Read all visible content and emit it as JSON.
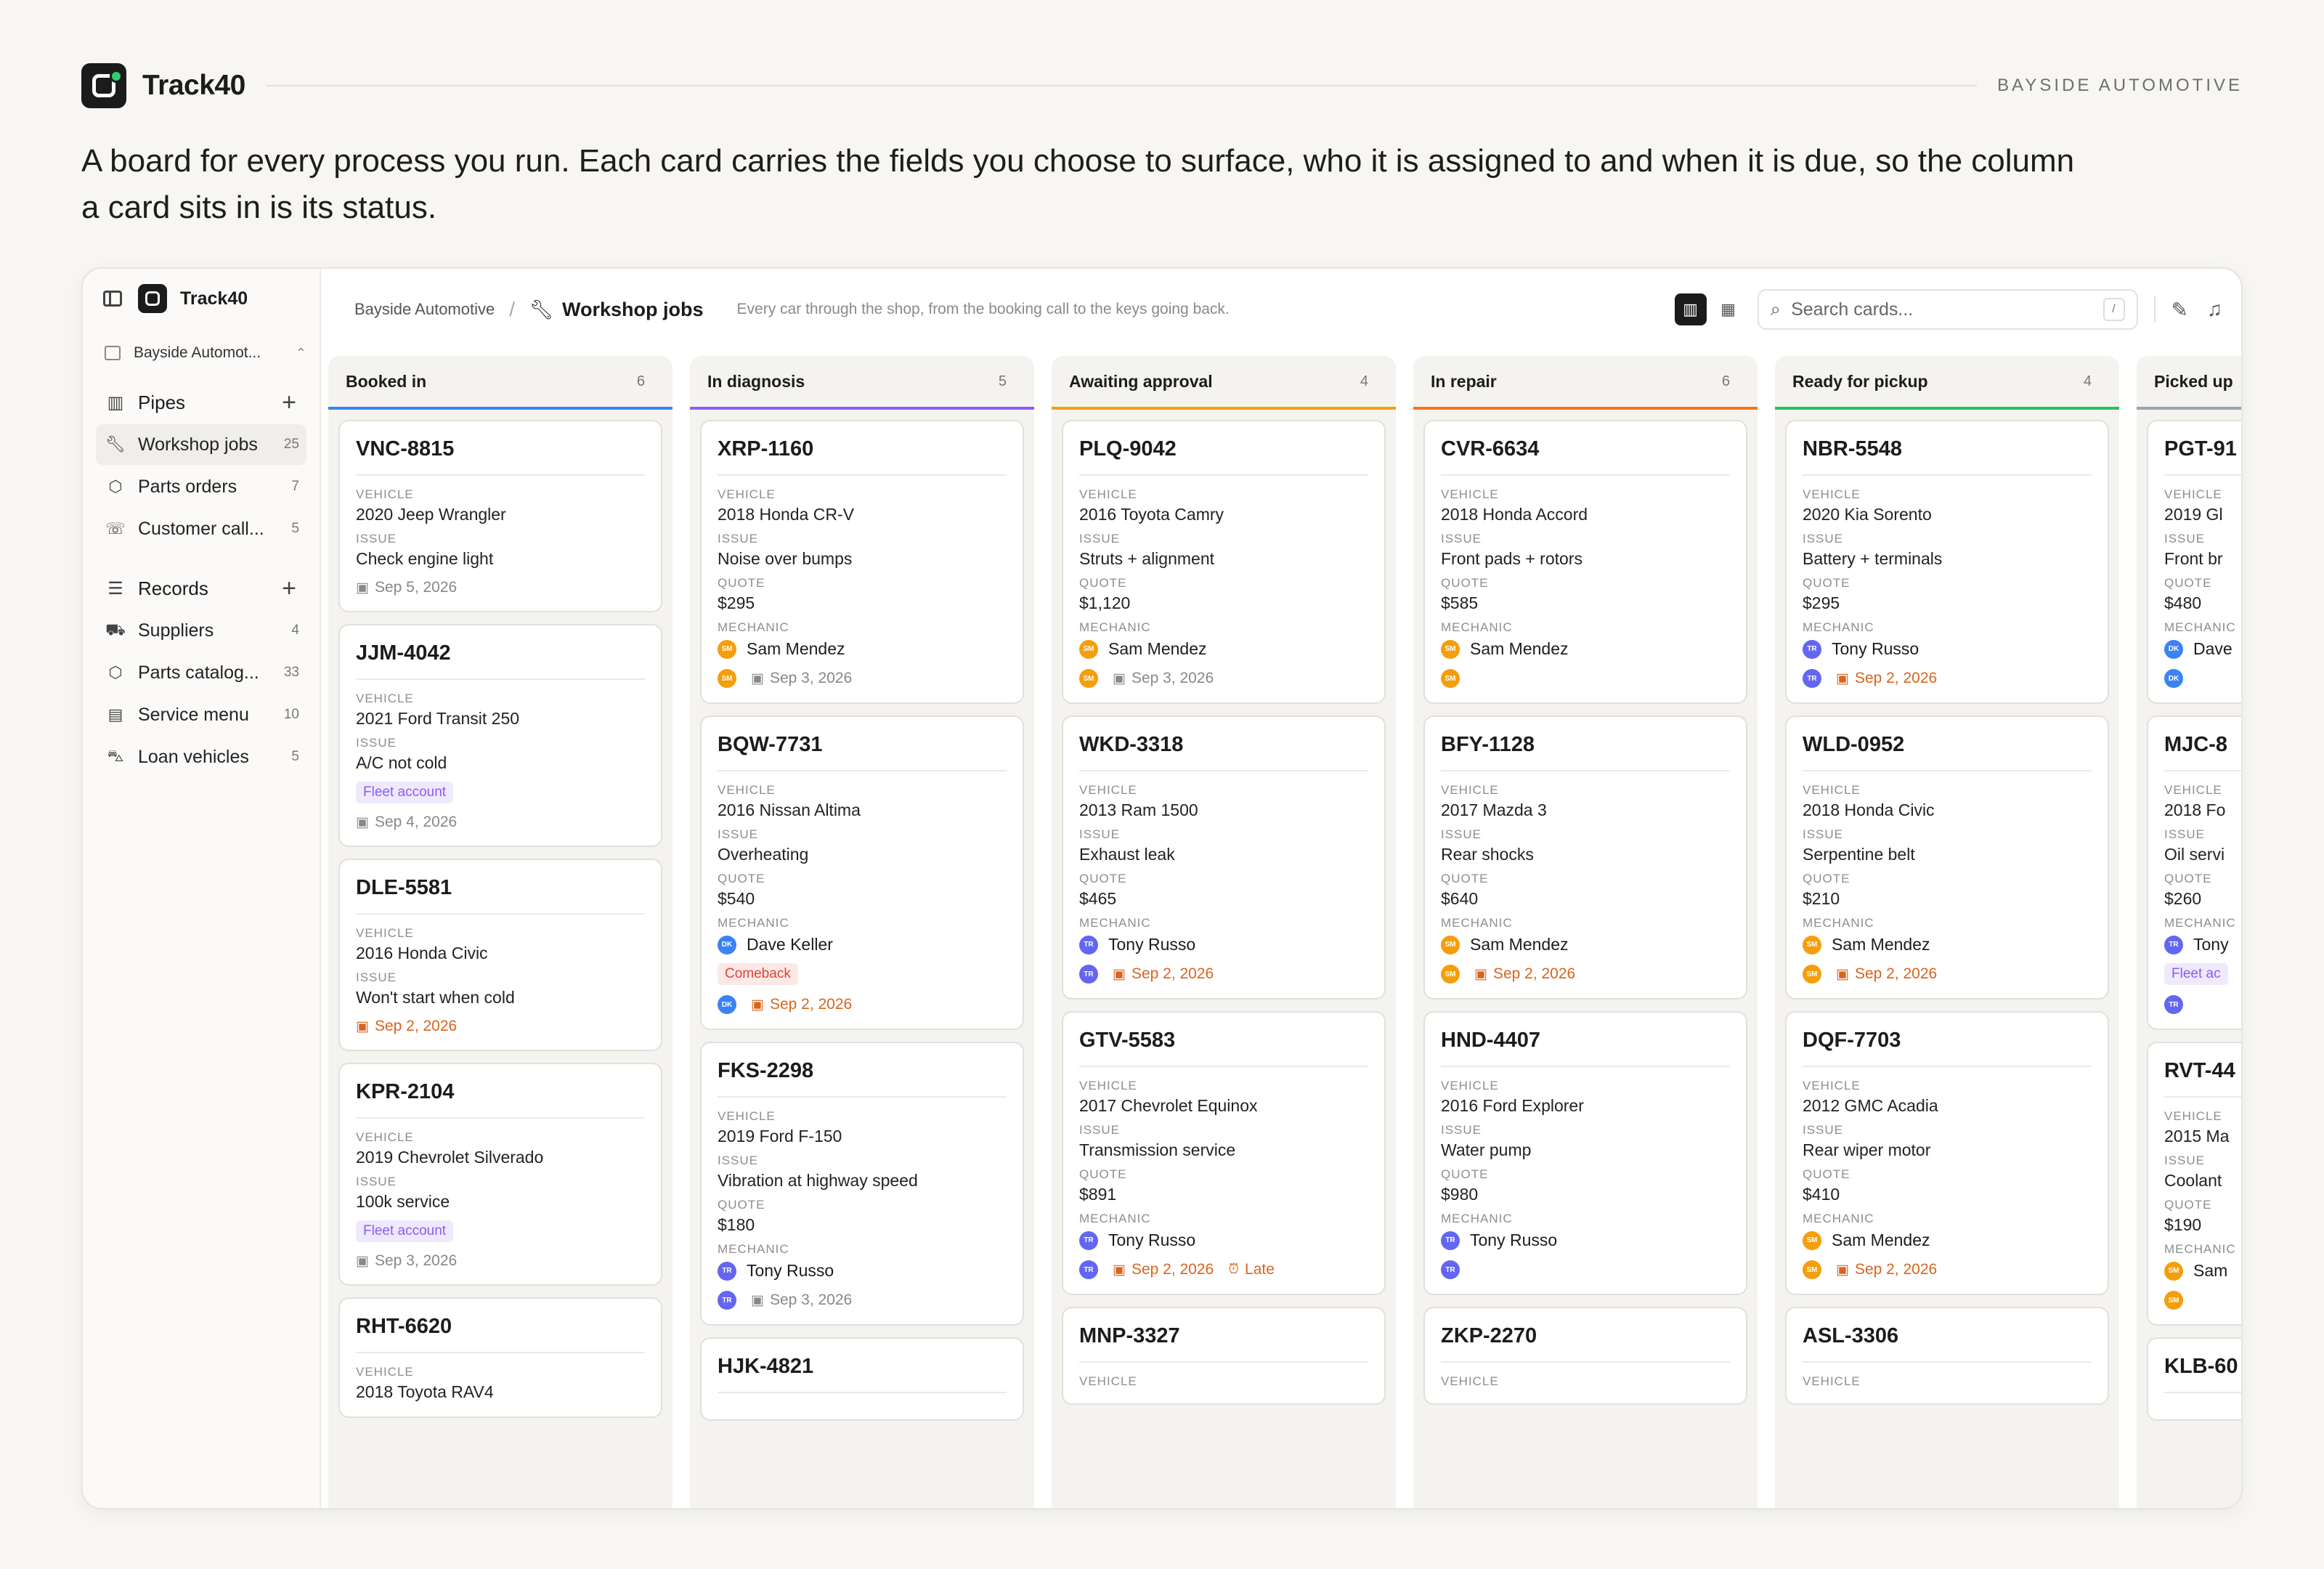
{
  "hero": {
    "brand": "Track40",
    "client": "BAYSIDE AUTOMOTIVE",
    "tagline": "A board for every process you run. Each card carries the fields you choose to surface, who it is assigned to and when it is due, so the column a card sits in is its status."
  },
  "sidebar": {
    "brand": "Track40",
    "workspace": "Bayside Automot...",
    "pipes_label": "Pipes",
    "pipes": [
      {
        "label": "Workshop jobs",
        "count": "25",
        "icon": "wrench-icon",
        "active": true
      },
      {
        "label": "Parts orders",
        "count": "7",
        "icon": "box-icon"
      },
      {
        "label": "Customer call...",
        "count": "5",
        "icon": "phone-icon"
      }
    ],
    "records_label": "Records",
    "records": [
      {
        "label": "Suppliers",
        "count": "4",
        "icon": "truck-icon"
      },
      {
        "label": "Parts catalog...",
        "count": "33",
        "icon": "box-icon"
      },
      {
        "label": "Service menu",
        "count": "10",
        "icon": "clipboard-icon"
      },
      {
        "label": "Loan vehicles",
        "count": "5",
        "icon": "car-icon"
      }
    ]
  },
  "topbar": {
    "workspace": "Bayside Automotive",
    "separator": "/",
    "page": "Workshop jobs",
    "description": "Every car through the shop, from the booking call to the keys going back.",
    "search_placeholder": "Search cards...",
    "search_shortcut": "/"
  },
  "labels": {
    "vehicle": "VEHICLE",
    "issue": "ISSUE",
    "quote": "QUOTE",
    "mechanic": "MECHANIC"
  },
  "colors": {
    "booked": "#3b82f6",
    "diagnosis": "#8b5cf6",
    "approval": "#f59e0b",
    "repair": "#f97316",
    "ready": "#22c55e",
    "picked": "#9ca3af",
    "overdue": "#d9641e",
    "sam": "#f59e0b",
    "tony": "#6366f1",
    "dave": "#3b82f6"
  },
  "columns": [
    {
      "title": "Booked in",
      "count": "6",
      "color": "#3b82f6",
      "cards": [
        {
          "id": "VNC-8815",
          "vehicle": "2020 Jeep Wrangler",
          "issue": "Check engine light",
          "date": "Sep 5, 2026"
        },
        {
          "id": "JJM-4042",
          "vehicle": "2021 Ford Transit 250",
          "issue": "A/C not cold",
          "tag": "Fleet account",
          "date": "Sep 4, 2026"
        },
        {
          "id": "DLE-5581",
          "vehicle": "2016 Honda Civic",
          "issue": "Won't start when cold",
          "date": "Sep 2, 2026",
          "overdue": true
        },
        {
          "id": "KPR-2104",
          "vehicle": "2019 Chevrolet Silverado",
          "issue": "100k service",
          "tag": "Fleet account",
          "date": "Sep 3, 2026"
        },
        {
          "id": "RHT-6620",
          "vehicle": "2018 Toyota RAV4"
        }
      ]
    },
    {
      "title": "In diagnosis",
      "count": "5",
      "color": "#8b5cf6",
      "cards": [
        {
          "id": "XRP-1160",
          "vehicle": "2018 Honda CR-V",
          "issue": "Noise over bumps",
          "quote": "$295",
          "mechanic": "Sam Mendez",
          "initials": "SM",
          "date": "Sep 3, 2026"
        },
        {
          "id": "BQW-7731",
          "vehicle": "2016 Nissan Altima",
          "issue": "Overheating",
          "quote": "$540",
          "mechanic": "Dave Keller",
          "initials": "DK",
          "tag": "Comeback",
          "date": "Sep 2, 2026",
          "overdue": true
        },
        {
          "id": "FKS-2298",
          "vehicle": "2019 Ford F-150",
          "issue": "Vibration at highway speed",
          "quote": "$180",
          "mechanic": "Tony Russo",
          "initials": "TR",
          "date": "Sep 3, 2026"
        },
        {
          "id": "HJK-4821"
        }
      ]
    },
    {
      "title": "Awaiting approval",
      "count": "4",
      "color": "#f59e0b",
      "cards": [
        {
          "id": "PLQ-9042",
          "vehicle": "2016 Toyota Camry",
          "issue": "Struts + alignment",
          "quote": "$1,120",
          "mechanic": "Sam Mendez",
          "initials": "SM",
          "date": "Sep 3, 2026"
        },
        {
          "id": "WKD-3318",
          "vehicle": "2013 Ram 1500",
          "issue": "Exhaust leak",
          "quote": "$465",
          "mechanic": "Tony Russo",
          "initials": "TR",
          "date": "Sep 2, 2026",
          "overdue": true
        },
        {
          "id": "GTV-5583",
          "vehicle": "2017 Chevrolet Equinox",
          "issue": "Transmission service",
          "quote": "$891",
          "mechanic": "Tony Russo",
          "initials": "TR",
          "date": "Sep 2, 2026",
          "overdue": true,
          "late": "Late"
        },
        {
          "id": "MNP-3327",
          "vehicle_only_label": true
        }
      ]
    },
    {
      "title": "In repair",
      "count": "6",
      "color": "#f97316",
      "cards": [
        {
          "id": "CVR-6634",
          "vehicle": "2018 Honda Accord",
          "issue": "Front pads + rotors",
          "quote": "$585",
          "mechanic": "Sam Mendez",
          "initials": "SM"
        },
        {
          "id": "BFY-1128",
          "vehicle": "2017 Mazda 3",
          "issue": "Rear shocks",
          "quote": "$640",
          "mechanic": "Sam Mendez",
          "initials": "SM",
          "date": "Sep 2, 2026",
          "overdue": true
        },
        {
          "id": "HND-4407",
          "vehicle": "2016 Ford Explorer",
          "issue": "Water pump",
          "quote": "$980",
          "mechanic": "Tony Russo",
          "initials": "TR"
        },
        {
          "id": "ZKP-2270",
          "vehicle_only_label": true
        }
      ]
    },
    {
      "title": "Ready for pickup",
      "count": "4",
      "color": "#22c55e",
      "cards": [
        {
          "id": "NBR-5548",
          "vehicle": "2020 Kia Sorento",
          "issue": "Battery + terminals",
          "quote": "$295",
          "mechanic": "Tony Russo",
          "initials": "TR",
          "date": "Sep 2, 2026",
          "overdue": true
        },
        {
          "id": "WLD-0952",
          "vehicle": "2018 Honda Civic",
          "issue": "Serpentine belt",
          "quote": "$210",
          "mechanic": "Sam Mendez",
          "initials": "SM",
          "date": "Sep 2, 2026",
          "overdue": true
        },
        {
          "id": "DQF-7703",
          "vehicle": "2012 GMC Acadia",
          "issue": "Rear wiper motor",
          "quote": "$410",
          "mechanic": "Sam Mendez",
          "initials": "SM",
          "date": "Sep 2, 2026",
          "overdue": true
        },
        {
          "id": "ASL-3306",
          "vehicle_only_label": true
        }
      ]
    },
    {
      "title": "Picked up",
      "count": "",
      "color": "#9ca3af",
      "cards": [
        {
          "id": "PGT-91",
          "vehicle": "2019 Gl",
          "issue": "Front br",
          "quote": "$480",
          "mechanic": "Dave",
          "initials": "DK"
        },
        {
          "id": "MJC-8",
          "vehicle": "2018 Fo",
          "issue": "Oil servi",
          "quote": "$260",
          "mechanic": "Tony",
          "initials": "TR",
          "tag": "Fleet ac"
        },
        {
          "id": "RVT-44",
          "vehicle": "2015 Ma",
          "issue": "Coolant",
          "quote": "$190",
          "mechanic": "Sam",
          "initials": "SM"
        },
        {
          "id": "KLB-60"
        }
      ]
    }
  ]
}
